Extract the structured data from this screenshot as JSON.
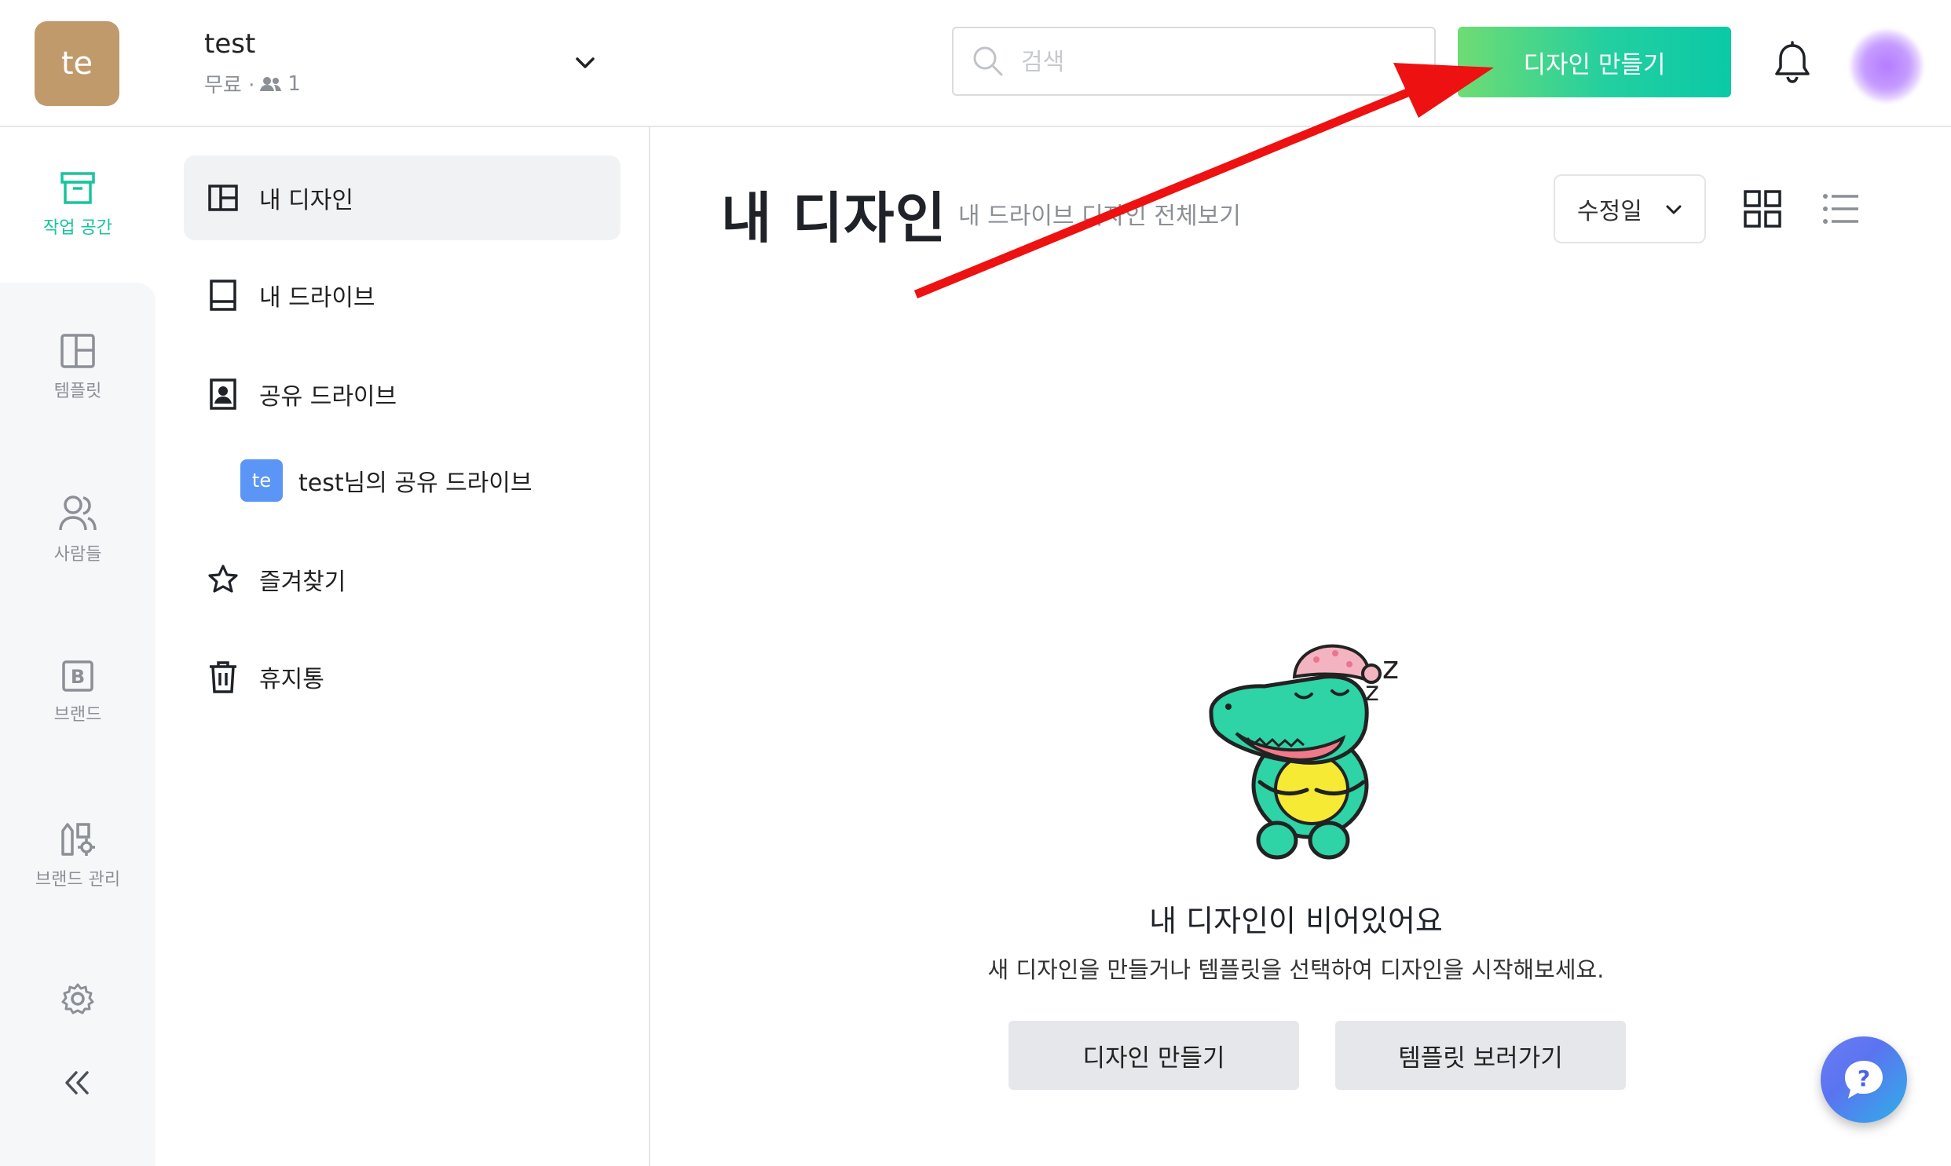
{
  "header": {
    "workspace_avatar": "te",
    "workspace_name": "test",
    "plan": "무료 ·",
    "member_count": "1",
    "search_placeholder": "검색",
    "create_button": "디자인 만들기"
  },
  "rail": {
    "items": [
      {
        "label": "작업 공간",
        "icon": "archive-box-icon"
      },
      {
        "label": "템플릿",
        "icon": "layout-grid-icon"
      },
      {
        "label": "사람들",
        "icon": "people-icon"
      },
      {
        "label": "브랜드",
        "icon": "brand-b-icon"
      },
      {
        "label": "브랜드 관리",
        "icon": "brand-manage-icon"
      }
    ]
  },
  "nav": {
    "my_designs": "내 디자인",
    "my_drive": "내 드라이브",
    "shared_drive": "공유 드라이브",
    "shared_sub_avatar": "te",
    "shared_sub_label": "test님의 공유 드라이브",
    "favorites": "즐겨찾기",
    "trash": "휴지통"
  },
  "main": {
    "title": "내 디자인",
    "subtitle": "내 드라이브 디자인 전체보기",
    "sort_value": "수정일"
  },
  "empty_state": {
    "title": "내 디자인이 비어있어요",
    "description": "새 디자인을 만들거나 템플릿을 선택하여 디자인을 시작해보세요.",
    "create_button": "디자인 만들기",
    "templates_button": "템플릿 보러가기"
  },
  "colors": {
    "accent": "#19c49d",
    "annotation_arrow": "#ee1111",
    "help_button": "#5a74f0"
  }
}
